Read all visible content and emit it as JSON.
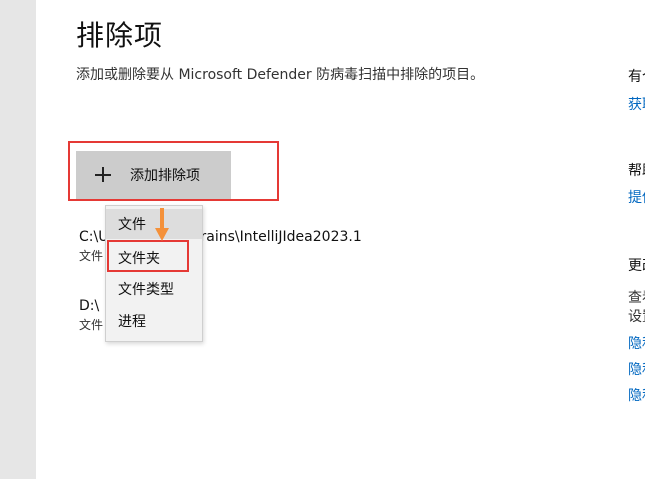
{
  "page": {
    "title": "排除项",
    "description": "添加或删除要从 Microsoft Defender 防病毒扫描中排除的项目。"
  },
  "add_button": {
    "label": "添加排除项",
    "icon": "plus-icon"
  },
  "exclusions": [
    {
      "path": "C:\\U                 ta\\Local\\JetBrains\\IntelliJIdea2023.1",
      "type": "文件"
    },
    {
      "path": "D:\\",
      "type": "文件"
    }
  ],
  "dropdown_menu": {
    "items": [
      {
        "label": "文件"
      },
      {
        "label": "文件夹"
      },
      {
        "label": "文件类型"
      },
      {
        "label": "进程"
      }
    ]
  },
  "right_panel": {
    "lines": [
      {
        "text": "有个",
        "kind": "heading"
      },
      {
        "text": "获取",
        "kind": "link"
      },
      {
        "text": "帮助",
        "kind": "heading"
      },
      {
        "text": "提供",
        "kind": "link"
      },
      {
        "text": "更改",
        "kind": "heading"
      },
      {
        "text": "查看",
        "kind": "body"
      },
      {
        "text": "设置",
        "kind": "body"
      },
      {
        "text": "隐私",
        "kind": "link"
      },
      {
        "text": "隐私",
        "kind": "link"
      },
      {
        "text": "隐私",
        "kind": "link"
      }
    ]
  },
  "colors": {
    "highlight": "#e53935",
    "arrow": "#f4913a",
    "link": "#0067c0",
    "button_bg": "#cccccc"
  }
}
